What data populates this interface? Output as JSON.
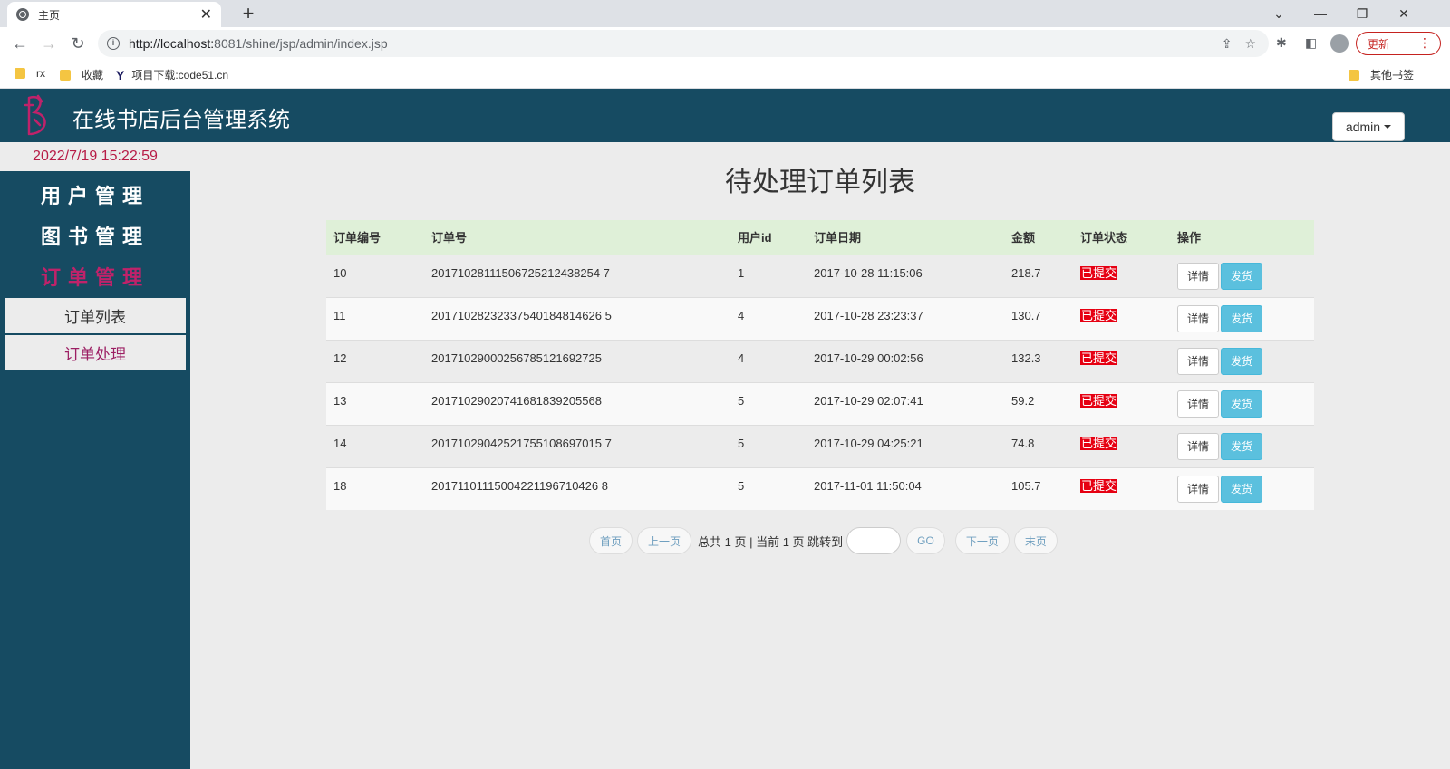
{
  "browser": {
    "tab_title": "主页",
    "url_host": "http://localhost:",
    "url_rest": "8081/shine/jsp/admin/index.jsp",
    "update_label": "更新",
    "bookmarks": [
      "rx",
      "收藏",
      "项目下载:code51.cn"
    ],
    "other_bookmarks": "其他书签"
  },
  "header": {
    "title": "在线书店后台管理系统",
    "user_menu": "admin"
  },
  "sidebar": {
    "datetime": "2022/7/19 15:22:59",
    "menus": [
      "用户管理",
      "图书管理",
      "订单管理"
    ],
    "submenus": [
      "订单列表",
      "订单处理"
    ]
  },
  "main": {
    "title": "待处理订单列表",
    "columns": [
      "订单编号",
      "订单号",
      "用户id",
      "订单日期",
      "金额",
      "订单状态",
      "操作"
    ],
    "rows": [
      [
        "10",
        "20171028111506725212438254 7",
        "1",
        "2017-10-28 11:15:06",
        "218.7",
        "已提交"
      ],
      [
        "11",
        "20171028232337540184814626 5",
        "4",
        "2017-10-28 23:23:37",
        "130.7",
        "已提交"
      ],
      [
        "12",
        "20171029000256785121692725",
        "4",
        "2017-10-29 00:02:56",
        "132.3",
        "已提交"
      ],
      [
        "13",
        "20171029020741681839205568",
        "5",
        "2017-10-29 02:07:41",
        "59.2",
        "已提交"
      ],
      [
        "14",
        "20171029042521755108697015 7",
        "5",
        "2017-10-29 04:25:21",
        "74.8",
        "已提交"
      ],
      [
        "18",
        "20171101115004221196710426 8",
        "5",
        "2017-11-01 11:50:04",
        "105.7",
        "已提交"
      ]
    ],
    "detail_label": "详情",
    "ship_label": "发货"
  },
  "pager": {
    "first": "首页",
    "prev": "上一页",
    "summary": "总共 1 页 | 当前 1 页 跳转到",
    "go": "GO",
    "next": "下一页",
    "last": "末页"
  }
}
